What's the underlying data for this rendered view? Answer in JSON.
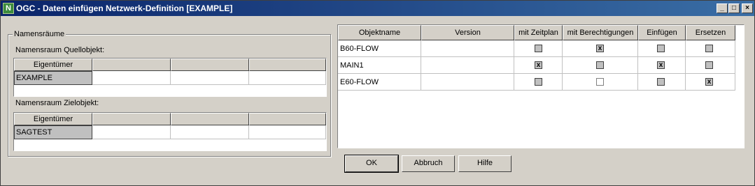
{
  "window": {
    "title": "OGC - Daten einfügen Netzwerk-Definition [EXAMPLE]",
    "app_icon": "N",
    "min": "_",
    "max": "□",
    "close": "×"
  },
  "namespaces": {
    "group_label": "Namensräume",
    "source_label": "Namensraum Quellobjekt:",
    "target_label": "Namensraum Zielobjekt:",
    "owner_header": "Eigentümer",
    "source_owner": "EXAMPLE",
    "target_owner": "SAGTEST"
  },
  "objects": {
    "headers": [
      "Objektname",
      "Version",
      "mit Zeitplan",
      "mit Berechtigungen",
      "Einfügen",
      "Ersetzen"
    ],
    "rows": [
      {
        "name": "B60-FLOW",
        "version": "",
        "zeitplan": "",
        "berechtigungen": "x",
        "einfuegen": "",
        "ersetzen": ""
      },
      {
        "name": "MAIN1",
        "version": "",
        "zeitplan": "x",
        "berechtigungen": "",
        "einfuegen": "x",
        "ersetzen": ""
      },
      {
        "name": "E60-FLOW",
        "version": "",
        "zeitplan": "",
        "berechtigungen": "",
        "einfuegen": "",
        "ersetzen": "x"
      }
    ]
  },
  "buttons": {
    "ok": "OK",
    "cancel": "Abbruch",
    "help": "Hilfe"
  }
}
